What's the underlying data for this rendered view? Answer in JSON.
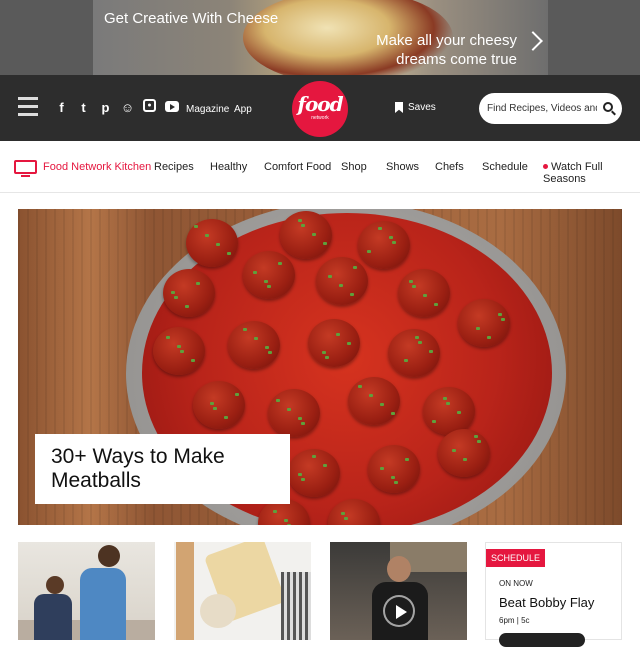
{
  "ad": {
    "headline": "Get Creative With Cheese",
    "subline": "Make all your cheesy dreams come true"
  },
  "header": {
    "social_icons": [
      "facebook-icon",
      "twitter-icon",
      "pinterest-icon",
      "snapchat-icon",
      "instagram-icon",
      "youtube-icon"
    ],
    "links": {
      "magazine": "Magazine",
      "app": "App"
    },
    "logo": {
      "word": "food",
      "sub": "network"
    },
    "saves_label": "Saves",
    "search_placeholder": "Find Recipes, Videos and More"
  },
  "nav": {
    "kitchen": "Food Network Kitchen",
    "items": [
      "Recipes",
      "Healthy",
      "Comfort Food",
      "Shop",
      "Shows",
      "Chefs",
      "Schedule",
      "Watch Full Seasons"
    ]
  },
  "hero": {
    "caption": "30+ Ways to Make Meatballs"
  },
  "schedule": {
    "tag": "SCHEDULE",
    "on_now": "ON NOW",
    "show": "Beat Bobby Flay",
    "time": "6pm | 5c"
  },
  "colors": {
    "brand_red": "#e5173f",
    "header_bg": "#2d2d2d"
  }
}
